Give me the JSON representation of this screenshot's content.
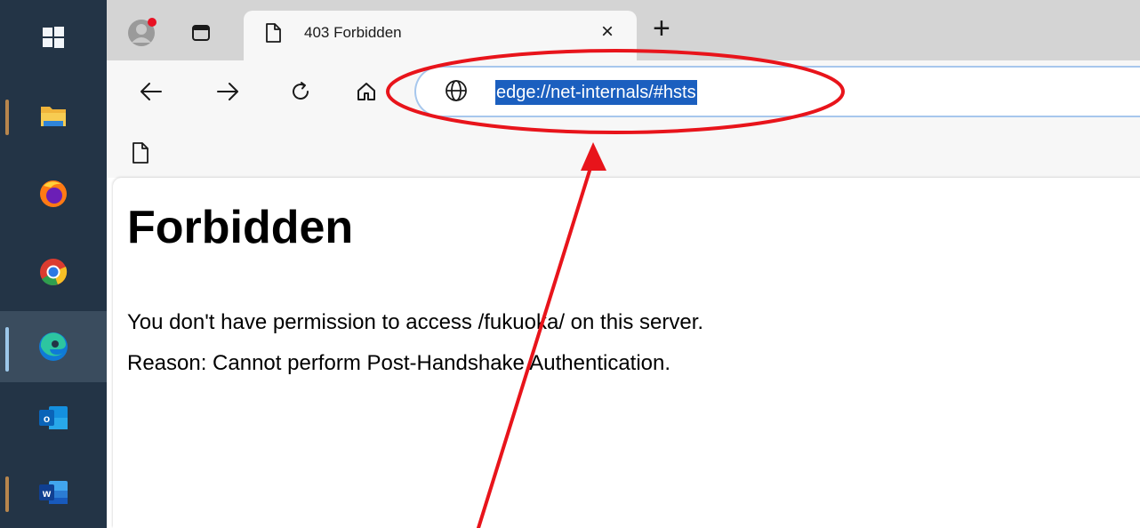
{
  "browser": {
    "tab": {
      "title": "403 Forbidden",
      "close_glyph": "×"
    },
    "new_tab_glyph": "+",
    "address": {
      "url": "edge://net-internals/#hsts"
    },
    "nav_icons": [
      "back-arrow-icon",
      "forward-arrow-icon",
      "refresh-icon",
      "home-icon"
    ]
  },
  "page": {
    "heading": "Forbidden",
    "line1": "You don't have permission to access /fukuoka/ on this server.",
    "line2": "Reason: Cannot perform Post-Handshake Authentication."
  },
  "taskbar": {
    "apps": [
      "windows-start-icon",
      "file-explorer-icon",
      "firefox-icon",
      "chrome-icon",
      "edge-icon",
      "outlook-icon",
      "word-icon"
    ]
  },
  "annotation": {
    "color": "#e8141b",
    "shapes": [
      "ellipse-around-address-bar",
      "arrow-pointing-to-address-bar"
    ]
  },
  "colors": {
    "taskbar": "#233446",
    "selection": "#1b5fbf",
    "address_border": "#a7c7ed"
  }
}
